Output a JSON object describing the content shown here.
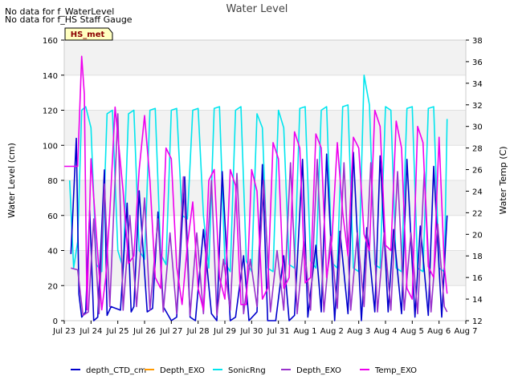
{
  "notes": [
    "No data for f_WaterLevel",
    "No data for f_HS Staff Gauge"
  ],
  "badge": "HS_met",
  "chart_data": {
    "type": "line",
    "title": "Water Level",
    "xlabel": "",
    "ylabel": "Water Level (cm)",
    "y2label": "Water Temp (C)",
    "ylim": [
      0,
      160
    ],
    "y2lim": [
      12,
      38
    ],
    "xlim": [
      0,
      15
    ],
    "x_ticks": [
      0,
      1,
      2,
      3,
      4,
      5,
      6,
      7,
      8,
      9,
      10,
      11,
      12,
      13,
      14,
      15
    ],
    "x_tick_labels": [
      "Jul 23",
      "Jul 24",
      "Jul 25",
      "Jul 26",
      "Jul 27",
      "Jul 28",
      "Jul 29",
      "Jul 30",
      "Jul 31",
      "Aug 1",
      "Aug 2",
      "Aug 3",
      "Aug 4",
      "Aug 5",
      "Aug 6",
      "Aug 7"
    ],
    "y_ticks": [
      0,
      20,
      40,
      60,
      80,
      100,
      120,
      140,
      160
    ],
    "y2_ticks": [
      12,
      14,
      16,
      18,
      20,
      22,
      24,
      26,
      28,
      30,
      32,
      34,
      36,
      38
    ],
    "x_unit_note": "days after Jul 23 00:00",
    "grid": "horizontal bands",
    "legend_position": "bottom",
    "legend": [
      "depth_CTD_cm",
      "Depth_EXO",
      "SonicRng",
      "Depth_EXO",
      "Temp_EXO"
    ],
    "series": [
      {
        "name": "depth_CTD_cm",
        "color": "#0000cc",
        "axis": "left",
        "x": [
          0.25,
          0.45,
          0.55,
          0.65,
          0.8,
          0.95,
          1.1,
          1.25,
          1.5,
          1.6,
          1.75,
          2.1,
          2.35,
          2.5,
          2.6,
          2.8,
          3.1,
          3.3,
          3.5,
          3.7,
          4.0,
          4.2,
          4.5,
          4.7,
          4.9,
          5.2,
          5.5,
          5.7,
          5.9,
          6.2,
          6.4,
          6.7,
          6.9,
          7.2,
          7.4,
          7.6,
          7.9,
          8.2,
          8.4,
          8.6,
          8.9,
          9.1,
          9.4,
          9.6,
          9.8,
          10.1,
          10.3,
          10.6,
          10.8,
          11.1,
          11.3,
          11.6,
          11.8,
          12.1,
          12.3,
          12.6,
          12.8,
          13.1,
          13.3,
          13.6,
          13.8,
          14.1,
          14.3
        ],
        "y": [
          38,
          104,
          15,
          2,
          5,
          63,
          0,
          2,
          86,
          3,
          8,
          6,
          67,
          5,
          8,
          74,
          5,
          7,
          62,
          8,
          0,
          2,
          82,
          2,
          0,
          52,
          4,
          0,
          85,
          0,
          2,
          37,
          0,
          5,
          89,
          0,
          0,
          37,
          0,
          3,
          92,
          2,
          43,
          5,
          95,
          0,
          51,
          4,
          96,
          0,
          53,
          5,
          94,
          5,
          52,
          4,
          92,
          2,
          54,
          3,
          88,
          2,
          60
        ],
        "approx": true
      },
      {
        "name": "SonicRng",
        "color": "#00e5ee",
        "axis": "left",
        "x": [
          0.2,
          0.35,
          0.5,
          0.65,
          0.8,
          1.0,
          1.2,
          1.4,
          1.6,
          1.8,
          2.0,
          2.2,
          2.4,
          2.6,
          2.8,
          3.0,
          3.2,
          3.4,
          3.6,
          3.8,
          4.0,
          4.2,
          4.4,
          4.6,
          4.8,
          5.0,
          5.2,
          5.4,
          5.6,
          5.8,
          6.0,
          6.2,
          6.4,
          6.6,
          6.8,
          7.0,
          7.2,
          7.4,
          7.6,
          7.8,
          8.0,
          8.2,
          8.4,
          8.6,
          8.8,
          9.0,
          9.2,
          9.4,
          9.6,
          9.8,
          10.0,
          10.2,
          10.4,
          10.6,
          10.8,
          11.0,
          11.2,
          11.4,
          11.6,
          11.8,
          12.0,
          12.2,
          12.4,
          12.6,
          12.8,
          13.0,
          13.2,
          13.4,
          13.6,
          13.8,
          14.0,
          14.2,
          14.3
        ],
        "y": [
          80,
          30,
          45,
          120,
          122,
          110,
          32,
          28,
          118,
          120,
          40,
          30,
          118,
          120,
          40,
          35,
          120,
          121,
          38,
          32,
          120,
          121,
          60,
          58,
          120,
          121,
          60,
          30,
          121,
          122,
          33,
          28,
          120,
          122,
          34,
          28,
          118,
          110,
          30,
          28,
          120,
          110,
          32,
          30,
          121,
          122,
          34,
          30,
          120,
          122,
          33,
          30,
          122,
          123,
          30,
          28,
          140,
          123,
          32,
          30,
          122,
          120,
          30,
          28,
          121,
          122,
          30,
          28,
          121,
          122,
          30,
          28,
          115
        ],
        "approx": true
      },
      {
        "name": "Depth_EXO",
        "color": "#9932cc",
        "axis": "left",
        "x": [
          0.25,
          0.5,
          0.7,
          0.9,
          1.1,
          1.3,
          1.5,
          1.7,
          2.0,
          2.2,
          2.45,
          2.7,
          3.0,
          3.2,
          3.5,
          3.7,
          3.95,
          4.2,
          4.45,
          4.7,
          4.95,
          5.2,
          5.5,
          5.7,
          5.95,
          6.2,
          6.45,
          6.7,
          6.95,
          7.2,
          7.45,
          7.7,
          7.95,
          8.2,
          8.45,
          8.7,
          8.95,
          9.2,
          9.45,
          9.7,
          9.95,
          10.2,
          10.45,
          10.7,
          10.95,
          11.2,
          11.45,
          11.7,
          11.95,
          12.2,
          12.45,
          12.7,
          12.95,
          13.2,
          13.45,
          13.7,
          13.95,
          14.2,
          14.3
        ],
        "y": [
          30,
          29,
          3,
          5,
          58,
          4,
          78,
          8,
          118,
          6,
          60,
          8,
          70,
          6,
          58,
          5,
          50,
          4,
          82,
          3,
          50,
          4,
          80,
          3,
          35,
          6,
          84,
          4,
          35,
          8,
          80,
          5,
          40,
          6,
          90,
          4,
          45,
          6,
          92,
          5,
          48,
          7,
          90,
          6,
          50,
          8,
          90,
          5,
          50,
          6,
          85,
          6,
          50,
          4,
          85,
          5,
          55,
          8,
          5
        ],
        "approx": true
      },
      {
        "name": "Temp_EXO",
        "color": "#ee00ee",
        "axis": "right",
        "x": [
          0.0,
          0.3,
          0.5,
          0.65,
          0.75,
          0.85,
          1.0,
          1.2,
          1.4,
          1.55,
          1.7,
          1.9,
          2.2,
          2.4,
          2.6,
          2.8,
          3.0,
          3.2,
          3.4,
          3.6,
          3.8,
          4.0,
          4.2,
          4.4,
          4.6,
          4.8,
          5.0,
          5.2,
          5.4,
          5.6,
          5.8,
          6.0,
          6.2,
          6.4,
          6.6,
          6.8,
          7.0,
          7.2,
          7.4,
          7.6,
          7.8,
          8.0,
          8.2,
          8.4,
          8.6,
          8.8,
          9.0,
          9.2,
          9.4,
          9.6,
          9.8,
          10.0,
          10.2,
          10.4,
          10.6,
          10.8,
          11.0,
          11.2,
          11.4,
          11.6,
          11.8,
          12.0,
          12.2,
          12.4,
          12.6,
          12.8,
          13.0,
          13.2,
          13.4,
          13.6,
          13.8,
          14.0,
          14.2,
          14.3
        ],
        "y": [
          26.3,
          26.3,
          26.3,
          36.5,
          33.0,
          13.0,
          27.0,
          20.0,
          13.0,
          16.0,
          22.0,
          31.8,
          24.0,
          17.3,
          18.0,
          26.0,
          31.0,
          25.0,
          16.0,
          15.0,
          28.0,
          27.0,
          17.0,
          13.5,
          19.0,
          23.0,
          15.0,
          13.0,
          25.0,
          26.0,
          16.0,
          14.0,
          26.0,
          24.5,
          13.5,
          13.5,
          26.0,
          24.0,
          14.0,
          15.0,
          28.5,
          27.0,
          15.0,
          16.0,
          29.5,
          28.0,
          15.5,
          16.0,
          29.3,
          28.0,
          16.0,
          19.5,
          28.5,
          22.0,
          18.0,
          29.0,
          28.0,
          20.0,
          18.5,
          31.5,
          30.0,
          19.0,
          18.5,
          30.5,
          28.0,
          15.0,
          14.0,
          30.0,
          28.5,
          17.0,
          16.0,
          29.0,
          17.0,
          14.5
        ],
        "approx": true
      }
    ]
  }
}
